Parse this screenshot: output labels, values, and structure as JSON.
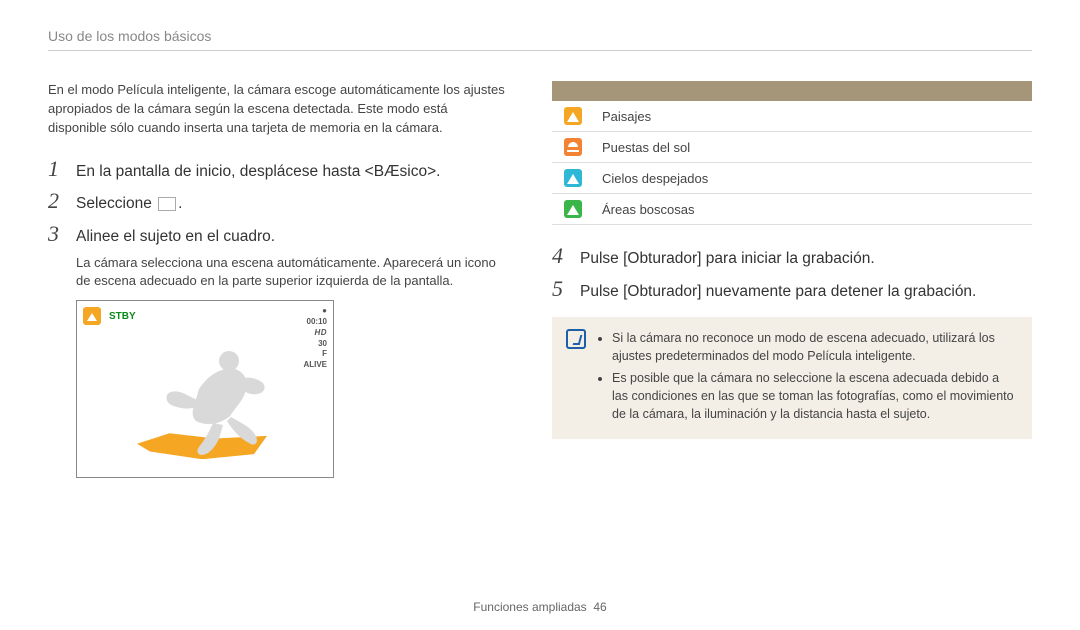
{
  "breadcrumb": "Uso de los modos básicos",
  "intro": "En el modo Película inteligente, la cámara escoge automáticamente los ajustes apropiados de la cámara según la escena detectada. Este modo está disponible sólo cuando inserta una tarjeta de memoria en la cámara.",
  "steps_left": [
    {
      "num": "1",
      "text": "En la pantalla de inicio, desplácese hasta <BÆsico>."
    },
    {
      "num": "2",
      "text": "Seleccione",
      "has_box": true,
      "suffix": "."
    },
    {
      "num": "3",
      "text": "Alinee el sujeto en el cuadro."
    }
  ],
  "sub_step3": "La cámara selecciona una escena automáticamente. Aparecerá un icono de escena adecuado en la parte superior izquierda de la pantalla.",
  "screen": {
    "stby": "STBY",
    "rec_ind": "●",
    "time": "00:10",
    "hd": "HD",
    "fps": "30",
    "f": "F",
    "alive": "ALIVE"
  },
  "scene_rows": [
    {
      "icon": "ico-landscape",
      "name": "landscape-icon",
      "label": "Paisajes"
    },
    {
      "icon": "ico-sunset",
      "name": "sunset-icon",
      "label": "Puestas del sol"
    },
    {
      "icon": "ico-sky",
      "name": "clear-sky-icon",
      "label": "Cielos despejados"
    },
    {
      "icon": "ico-forest",
      "name": "forest-icon",
      "label": "Áreas boscosas"
    }
  ],
  "steps_right": [
    {
      "num": "4",
      "text": "Pulse [Obturador] para iniciar la grabación."
    },
    {
      "num": "5",
      "text": "Pulse [Obturador] nuevamente para detener la grabación."
    }
  ],
  "note": [
    "Si la cámara no reconoce un modo de escena adecuado, utilizará los ajustes predeterminados del modo Película inteligente.",
    "Es posible que la cámara no seleccione la escena adecuada debido a las condiciones en las que se toman las fotografías, como el movimiento de la cámara, la iluminación y la distancia hasta el sujeto."
  ],
  "footer_label": "Funciones ampliadas",
  "footer_page": "46"
}
